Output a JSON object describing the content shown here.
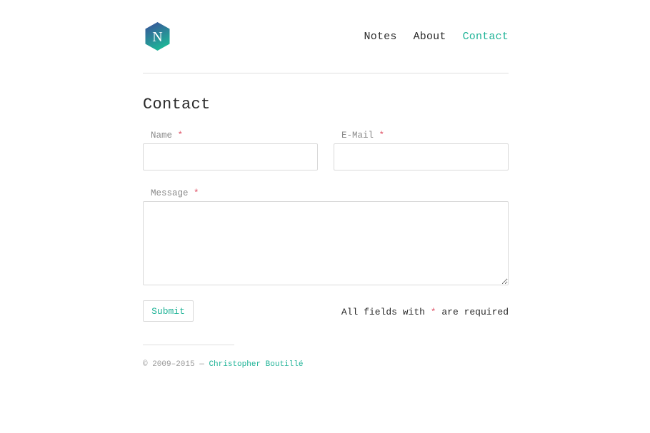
{
  "site": {
    "logo_letter": "N",
    "logo_colors": {
      "top": "#3a4d9a",
      "bottom": "#1fb397"
    }
  },
  "nav": {
    "items": [
      {
        "label": "Notes",
        "active": false
      },
      {
        "label": "About",
        "active": false
      },
      {
        "label": "Contact",
        "active": true
      }
    ]
  },
  "page": {
    "title": "Contact"
  },
  "form": {
    "name": {
      "label": "Name",
      "required_mark": "*",
      "value": ""
    },
    "email": {
      "label": "E-Mail",
      "required_mark": "*",
      "value": ""
    },
    "message": {
      "label": "Message",
      "required_mark": "*",
      "value": ""
    },
    "submit_label": "Submit",
    "required_note_prefix": "All fields with",
    "required_note_mark": "*",
    "required_note_suffix": "are required"
  },
  "footer": {
    "copyright": "© 2009–2015 —",
    "author": "Christopher Boutillé"
  },
  "colors": {
    "accent": "#1fb397",
    "required": "#e0566a",
    "text": "#2a2a2a",
    "muted": "#8a8a8a",
    "border": "#d9d9d9"
  }
}
